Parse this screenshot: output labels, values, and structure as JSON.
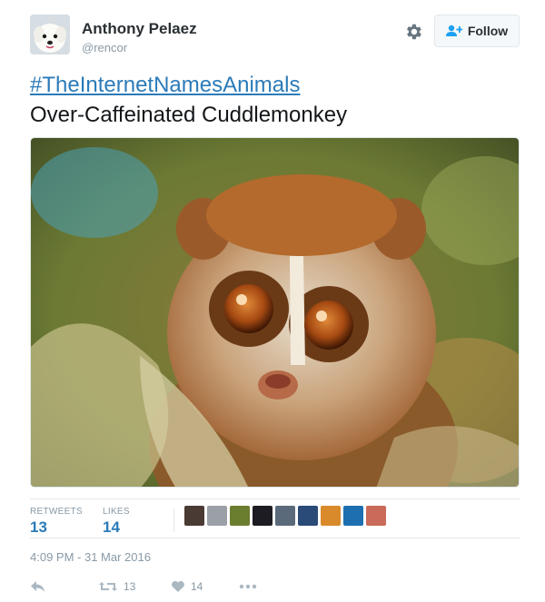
{
  "tweet": {
    "display_name": "Anthony Pelaez",
    "username": "@rencor",
    "follow_label": "Follow",
    "hashtag": "#TheInternetNamesAnimals",
    "text": "Over-Caffeinated Cuddlemonkey",
    "timestamp": "4:09 PM - 31 Mar 2016"
  },
  "stats": {
    "retweets_label": "RETWEETS",
    "retweets_count": "13",
    "likes_label": "LIKES",
    "likes_count": "14"
  },
  "actions": {
    "retweet_count": "13",
    "like_count": "14"
  },
  "colors": {
    "link": "#2b7bb9",
    "muted": "#8899a6",
    "text": "#292f33",
    "like_heart": "#aab8c2"
  },
  "likers": [
    {
      "name": "liker-avatar-1",
      "color": "#4a3a34"
    },
    {
      "name": "liker-avatar-2",
      "color": "#9aa0a6"
    },
    {
      "name": "liker-avatar-3",
      "color": "#6b7d2e"
    },
    {
      "name": "liker-avatar-4",
      "color": "#1c1c22"
    },
    {
      "name": "liker-avatar-5",
      "color": "#5a6a7a"
    },
    {
      "name": "liker-avatar-6",
      "color": "#2a4a78"
    },
    {
      "name": "liker-avatar-7",
      "color": "#d98a2b"
    },
    {
      "name": "liker-avatar-8",
      "color": "#1e6fb0"
    },
    {
      "name": "liker-avatar-9",
      "color": "#c96a5a"
    }
  ]
}
